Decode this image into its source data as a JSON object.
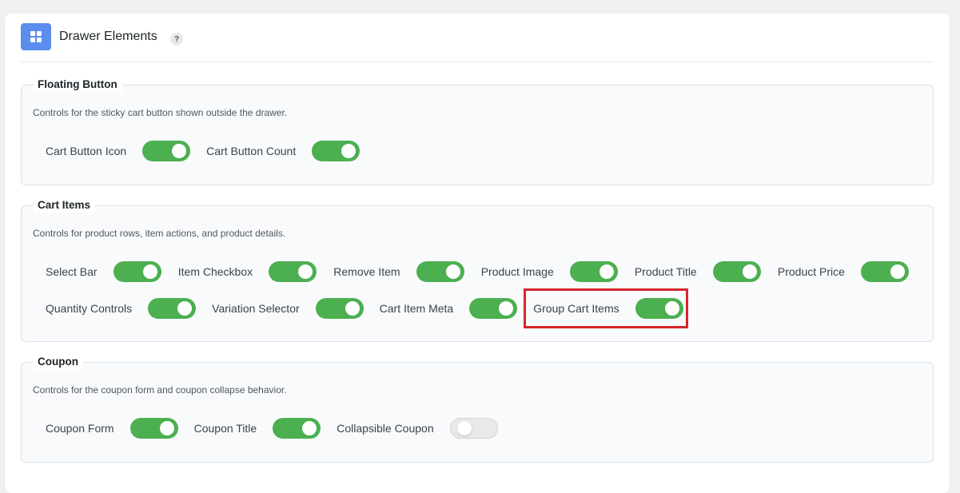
{
  "header": {
    "title": "Drawer Elements",
    "help": "?",
    "icon": "grid-icon",
    "icon_color": "#5b8def"
  },
  "colors": {
    "toggle_on": "#4caf50",
    "toggle_off": "#e9e9e9",
    "highlight": "#d9262a"
  },
  "sections": [
    {
      "title": "Floating Button",
      "description": "Controls for the sticky cart button shown outside the drawer.",
      "rows": [
        [
          {
            "label": "Cart Button Icon",
            "on": true
          },
          {
            "label": "Cart Button Count",
            "on": true
          }
        ]
      ]
    },
    {
      "title": "Cart Items",
      "description": "Controls for product rows, item actions, and product details.",
      "rows": [
        [
          {
            "label": "Select Bar",
            "on": true
          },
          {
            "label": "Item Checkbox",
            "on": true
          },
          {
            "label": "Remove Item",
            "on": true
          },
          {
            "label": "Product Image",
            "on": true
          },
          {
            "label": "Product Title",
            "on": true
          },
          {
            "label": "Product Price",
            "on": true
          }
        ],
        [
          {
            "label": "Quantity Controls",
            "on": true
          },
          {
            "label": "Variation Selector",
            "on": true
          },
          {
            "label": "Cart Item Meta",
            "on": true
          },
          {
            "label": "Group Cart Items",
            "on": true,
            "highlighted": true
          }
        ]
      ]
    },
    {
      "title": "Coupon",
      "description": "Controls for the coupon form and coupon collapse behavior.",
      "rows": [
        [
          {
            "label": "Coupon Form",
            "on": true
          },
          {
            "label": "Coupon Title",
            "on": true
          },
          {
            "label": "Collapsible Coupon",
            "on": false
          }
        ]
      ]
    }
  ]
}
